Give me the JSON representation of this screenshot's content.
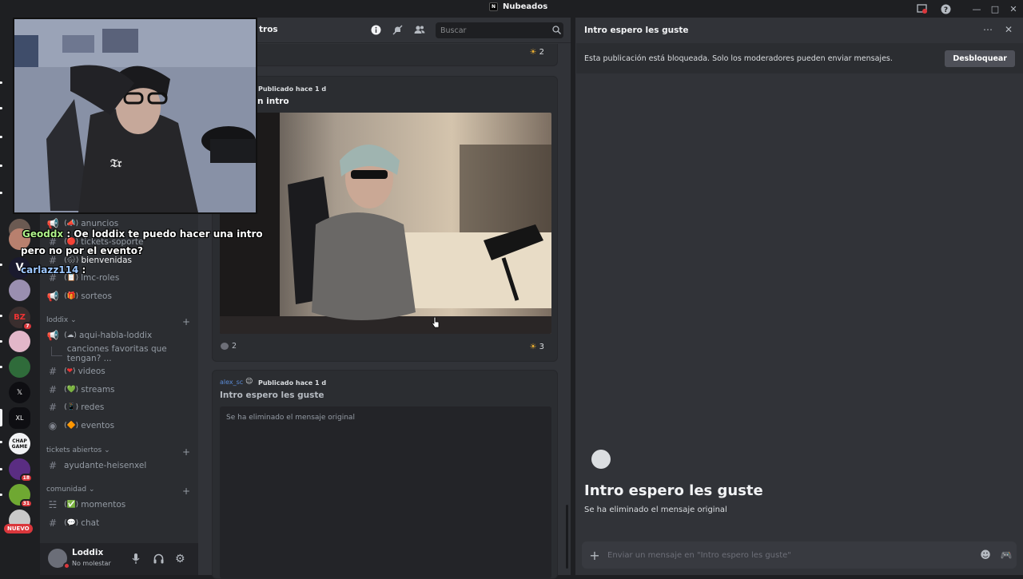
{
  "window": {
    "title": "Nubeados",
    "minimize_icon": "minimize-icon",
    "maximize_icon": "maximize-icon",
    "close_icon": "close-icon"
  },
  "server_list": {
    "badges": [
      "7",
      "18",
      "31"
    ],
    "new_label": "NUEVO"
  },
  "channels": {
    "items": [
      {
        "icon": "announce-icon",
        "emoji": "📣",
        "label": "anuncios"
      },
      {
        "icon": "hash-icon",
        "emoji": "🔴",
        "label": "tickets-soporte"
      },
      {
        "icon": "hash-icon",
        "emoji": "🌨",
        "label": "bienvenidas"
      },
      {
        "icon": "hash-icon",
        "emoji": "📋",
        "label": "lmc-roles"
      },
      {
        "icon": "announce-icon",
        "emoji": "🎁",
        "label": "sorteos"
      }
    ],
    "categories": [
      {
        "label": "loddix"
      },
      {
        "label": "tickets abiertos"
      },
      {
        "label": "comunidad"
      }
    ],
    "loddix_items": [
      {
        "icon": "announce-icon",
        "emoji": "☁",
        "label": "aqui-habla-loddix"
      },
      {
        "icon": "thread-branch",
        "emoji": "",
        "label": "canciones favoritas que tengan? ..."
      },
      {
        "icon": "hash-icon",
        "emoji": "❤",
        "label": "videos"
      },
      {
        "icon": "hash-icon",
        "emoji": "💚",
        "label": "streams"
      },
      {
        "icon": "hash-icon",
        "emoji": "📱",
        "label": "redes"
      },
      {
        "icon": "stage-icon",
        "emoji": "🔶",
        "label": "eventos"
      }
    ],
    "tickets_items": [
      {
        "icon": "hash-icon",
        "label": "ayudante-heisenxel"
      }
    ],
    "comunidad_items": [
      {
        "icon": "forum-icon",
        "emoji": "✅",
        "label": "momentos"
      },
      {
        "icon": "hash-icon",
        "emoji": "💬",
        "label": "chat"
      }
    ],
    "user": {
      "name": "Loddix",
      "status": "No molestar"
    }
  },
  "forum": {
    "title": "tros",
    "search_placeholder": "Buscar",
    "top_reaction": {
      "emoji": "☀",
      "count": "2"
    },
    "posts": [
      {
        "published": "Publicado hace 1 d",
        "title": "n intro",
        "comments": "2",
        "reaction": {
          "emoji": "☀",
          "count": "3"
        }
      },
      {
        "author": "alex_sc",
        "published": "Publicado hace 1 d",
        "title": "Intro espero les guste",
        "body": "Se ha eliminado el mensaje original"
      }
    ]
  },
  "thread": {
    "title": "Intro espero les guste",
    "locked_text": "Esta publicación está bloqueada. Solo los moderadores pueden enviar mensajes.",
    "unlock_label": "Desbloquear",
    "heading": "Intro espero les guste",
    "subtext": "Se ha eliminado el mensaje original",
    "message_placeholder": "Enviar un mensaje en \"Intro espero les guste\""
  },
  "stream_chat": {
    "line1_user": "Geoddx",
    "line1_text": " : Oe loddix te puedo hacer una intro",
    "line2_text": "pero no por el evento?",
    "line3_user": "carlazz114",
    "line3_text": " :"
  },
  "colors": {
    "accent": "#5865f2",
    "danger": "#da373c",
    "chat_user_green": "#aef28a",
    "chat_user_blue": "#9ec8ff"
  }
}
